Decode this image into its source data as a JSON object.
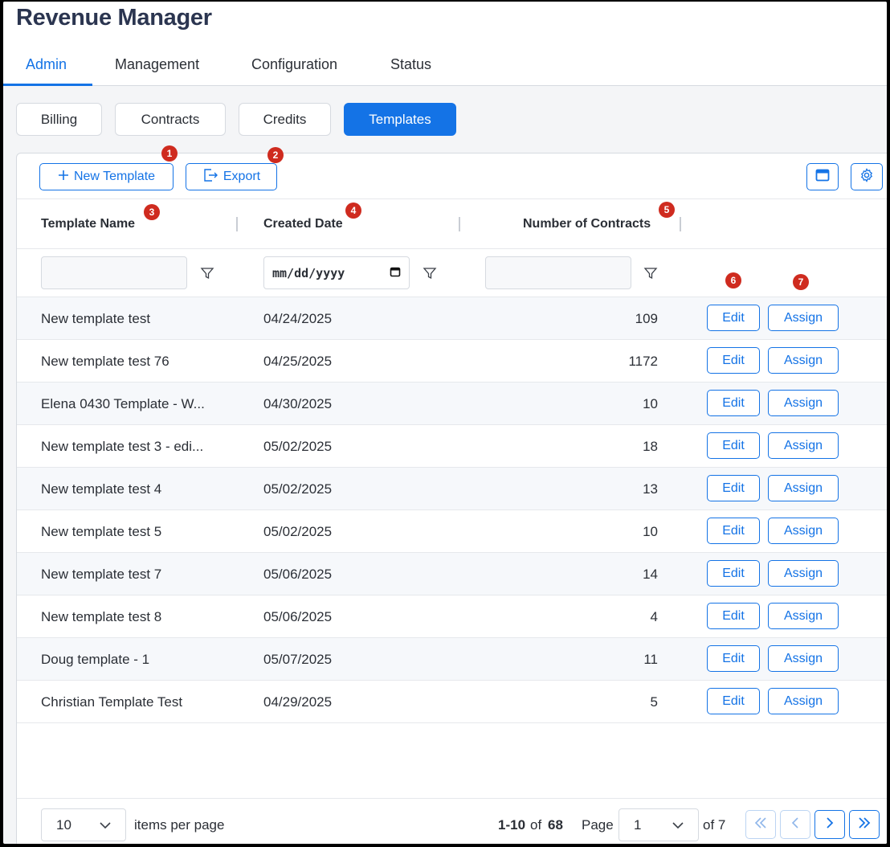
{
  "app": {
    "title": "Revenue Manager"
  },
  "main_tabs": [
    {
      "label": "Admin",
      "active": true
    },
    {
      "label": "Management"
    },
    {
      "label": "Configuration"
    },
    {
      "label": "Status"
    }
  ],
  "sub_tabs": [
    {
      "label": "Billing"
    },
    {
      "label": "Contracts"
    },
    {
      "label": "Credits"
    },
    {
      "label": "Templates",
      "active": true
    }
  ],
  "toolbar": {
    "new_template_label": "New Template",
    "export_label": "Export",
    "layout_icon": "window-layout-icon",
    "settings_icon": "gear-icon"
  },
  "badges": [
    "1",
    "2",
    "3",
    "4",
    "5",
    "6",
    "7"
  ],
  "columns": {
    "name": "Template Name",
    "date": "Created Date",
    "count": "Number of Contracts"
  },
  "filters": {
    "date_placeholder": "mm/dd/yyyy"
  },
  "rows": [
    {
      "name": "New template test",
      "date": "04/24/2025",
      "count": "109"
    },
    {
      "name": "New template test 76",
      "date": "04/25/2025",
      "count": "1172"
    },
    {
      "name": "Elena 0430 Template - W...",
      "date": "04/30/2025",
      "count": "10"
    },
    {
      "name": "New template test 3 - edi...",
      "date": "05/02/2025",
      "count": "18"
    },
    {
      "name": "New template test 4",
      "date": "05/02/2025",
      "count": "13"
    },
    {
      "name": "New template test 5",
      "date": "05/02/2025",
      "count": "10"
    },
    {
      "name": "New template test 7",
      "date": "05/06/2025",
      "count": "14"
    },
    {
      "name": "New template test 8",
      "date": "05/06/2025",
      "count": "4"
    },
    {
      "name": "Doug template - 1",
      "date": "05/07/2025",
      "count": "11"
    },
    {
      "name": "Christian Template Test",
      "date": "04/29/2025",
      "count": "5"
    }
  ],
  "row_actions": {
    "edit": "Edit",
    "assign": "Assign"
  },
  "pagination": {
    "page_size": "10",
    "items_per_page": "items per page",
    "range": "1-10",
    "of_label": "of",
    "total": "68",
    "page_label": "Page",
    "current_page": "1",
    "of_pages": "of 7"
  },
  "colors": {
    "accent": "#1473e6",
    "badge": "#cf2b1f",
    "title": "#2b3550"
  }
}
